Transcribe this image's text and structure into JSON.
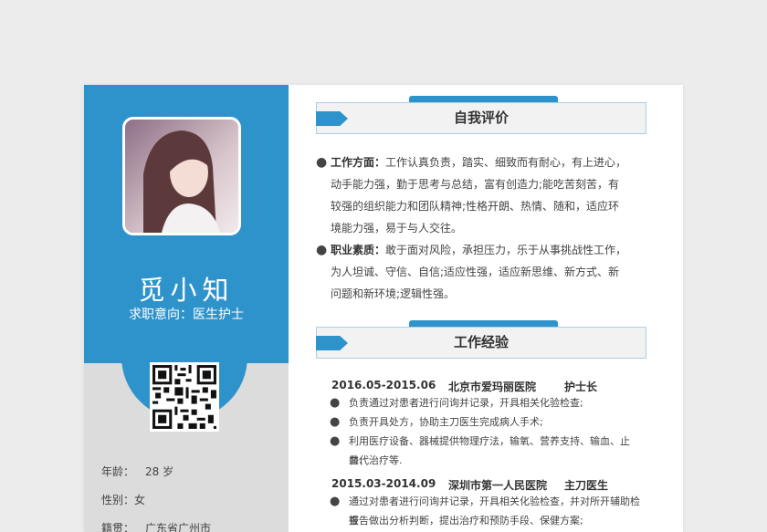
{
  "profile": {
    "name": "觅小知",
    "intent": "求职意向：医生护士",
    "age_label": "年龄：",
    "age_value": "28 岁",
    "gender_label": "性别：",
    "gender_value": "女",
    "hometown_label": "籍贯：",
    "hometown_value": "广东省广州市"
  },
  "self_eval": {
    "title": "自我评价",
    "items": [
      {
        "label": "工作方面：",
        "lines": [
          "工作认真负责，踏实、细致而有耐心，有上进心，",
          "动手能力强，勤于思考与总结，富有创造力;能吃苦刻苦，有",
          "较强的组织能力和团队精神;性格开朗、热情、随和，适应环",
          "境能力强，易于与人交往。"
        ]
      },
      {
        "label": "职业素质：",
        "lines": [
          "敢于面对风险，承担压力，乐于从事挑战性工作，",
          "为人坦诚、守信、自信;适应性强，适应新思维、新方式、新",
          "问题和新环境;逻辑性强。"
        ]
      }
    ]
  },
  "work": {
    "title": "工作经验",
    "jobs": [
      {
        "period": "2016.05-2015.06",
        "company": "北京市爱玛丽医院",
        "position": "护士长",
        "duties": [
          "负责通过对患者进行问询并记录，开具相关化验检查;",
          "负责开具处方，协助主刀医生完成病人手术;",
          "利用医疗设备、器械提供物理疗法，输氧、营养支持、输血、止血、",
          "替代治疗等."
        ]
      },
      {
        "period": "2015.03-2014.09",
        "company": "深圳市第一人民医院",
        "position": "主刀医生",
        "duties": [
          "通过对患者进行问询并记录，开具相关化验检查，并对所开辅助检查",
          "报告做出分析判断，提出治疗和预防手段、保健方案;"
        ]
      }
    ]
  },
  "colors": {
    "accent": "#2f93cb",
    "sidebar_gray": "#dcdcdc"
  }
}
